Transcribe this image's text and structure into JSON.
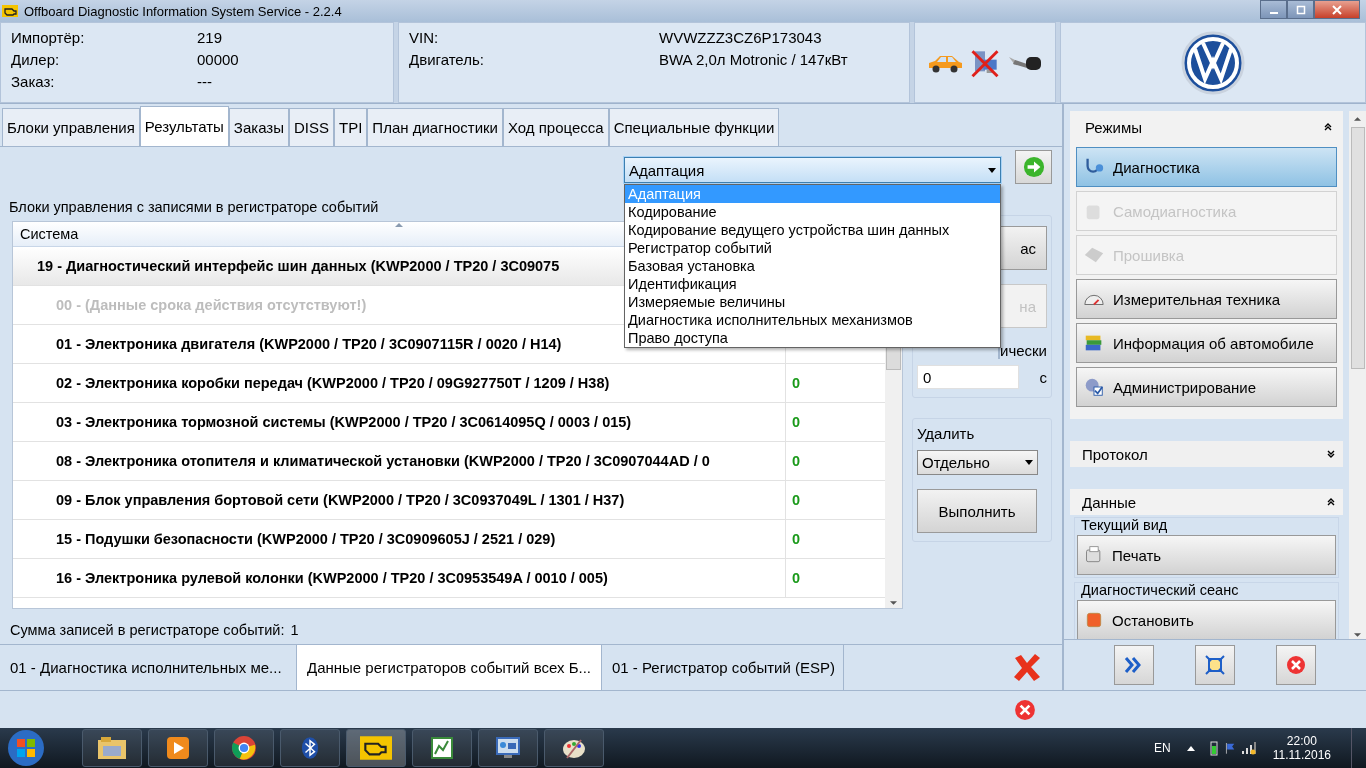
{
  "window": {
    "title": "Offboard Diagnostic Information System Service - 2.2.4"
  },
  "order": [
    {
      "label": "Импортёр:",
      "value": "219"
    },
    {
      "label": "Дилер:",
      "value": "00000"
    },
    {
      "label": "Заказ:",
      "value": "---"
    }
  ],
  "vehicle": [
    {
      "label": "VIN:",
      "value": "WVWZZZ3CZ6P173043"
    },
    {
      "label": "Двигатель:",
      "value": "BWA 2,0л Motronic / 147кВт"
    }
  ],
  "tabs": [
    {
      "label": "Блоки управления",
      "selected": false
    },
    {
      "label": "Результаты",
      "selected": true
    },
    {
      "label": "Заказы",
      "selected": false
    },
    {
      "label": "DISS",
      "selected": false
    },
    {
      "label": "TPI",
      "selected": false
    },
    {
      "label": "План диагностики",
      "selected": false
    },
    {
      "label": "Ход процесса",
      "selected": false
    },
    {
      "label": "Специальные функции",
      "selected": false
    }
  ],
  "function_select": {
    "value": "Адаптация",
    "expanded": true,
    "options": [
      {
        "label": "Адаптация",
        "selected": true
      },
      {
        "label": "Кодирование",
        "selected": false
      },
      {
        "label": "Кодирование ведущего устройства шин данных",
        "selected": false
      },
      {
        "label": "Регистратор событий",
        "selected": false
      },
      {
        "label": "Базовая установка",
        "selected": false
      },
      {
        "label": "Идентификация",
        "selected": false
      },
      {
        "label": "Измеряемые величины",
        "selected": false
      },
      {
        "label": "Диагностика исполнительных механизмов",
        "selected": false
      },
      {
        "label": "Право доступа",
        "selected": false
      }
    ]
  },
  "table": {
    "caption": "Блоки управления с записями в регистраторе событий",
    "columns": [
      "Система"
    ],
    "rows": [
      {
        "kind": "group",
        "name": "19 - Диагностический интерфейс шин данных  (KWP2000 / TP20 / 3C09075"
      },
      {
        "kind": "disabled",
        "name": "00 -   (Данные срока действия отсутствуют!)"
      },
      {
        "kind": "item",
        "name": "01 - Электроника двигателя  (KWP2000 / TP20 / 3C0907115R / 0020 / H14)"
      },
      {
        "kind": "item",
        "name": "02 - Электроника коробки передач  (KWP2000 / TP20 / 09G927750T / 1209 / H38)",
        "value": "0"
      },
      {
        "kind": "item",
        "name": "03 - Электроника тормозной системы  (KWP2000 / TP20 / 3C0614095Q / 0003 / 015)",
        "value": "0"
      },
      {
        "kind": "item",
        "name": "08 - Электроника отопителя и климатической установки  (KWP2000 / TP20 / 3C0907044AD / 0",
        "value": "0"
      },
      {
        "kind": "item",
        "name": "09 - Блок управления бортовой сети  (KWP2000 / TP20 / 3C0937049L / 1301 / H37)",
        "value": "0"
      },
      {
        "kind": "item",
        "name": "15 - Подушки безопасности  (KWP2000 / TP20 / 3C0909605J / 2521 / 029)",
        "value": "0"
      },
      {
        "kind": "item",
        "name": "16 - Электроника рулевой колонки  (KWP2000 / TP20 / 3C0953549A / 0010 / 005)",
        "value": "0"
      }
    ]
  },
  "side_buttons": [
    {
      "label": "ас",
      "disabled": false
    },
    {
      "label": "на",
      "disabled": true
    }
  ],
  "interval": {
    "title": "ически",
    "value": "0",
    "unit": "с"
  },
  "delete": {
    "title": "Удалить",
    "select": "Отдельно",
    "button": "Выполнить"
  },
  "summary": {
    "label": "Сумма записей в регистраторе событий:",
    "value": "1"
  },
  "bottom_tabs": [
    {
      "label": "01 - Диагностика исполнительных ме...",
      "selected": false
    },
    {
      "label": "Данные регистраторов событий всех Б...",
      "selected": true
    },
    {
      "label": "01 - Регистратор событий (ESP)",
      "selected": false
    }
  ],
  "sidebar": [
    {
      "kind": "modes",
      "title": "Режимы",
      "expanded": true,
      "items": [
        {
          "label": "Диагностика",
          "selected": true,
          "disabled": false
        },
        {
          "label": "Самодиагностика",
          "selected": false,
          "disabled": true
        },
        {
          "label": "Прошивка",
          "selected": false,
          "disabled": true
        },
        {
          "label": "Измерительная техника",
          "selected": false,
          "disabled": false
        },
        {
          "label": "Информация об автомобиле",
          "selected": false,
          "disabled": false
        },
        {
          "label": "Администрирование",
          "selected": false,
          "disabled": false
        }
      ]
    },
    {
      "kind": "collapsed",
      "title": "Протокол",
      "expanded": false
    },
    {
      "kind": "data",
      "title": "Данные",
      "expanded": true,
      "groups": [
        {
          "title": "Текущий вид",
          "button": "Печать"
        },
        {
          "title": "Диагностический сеанс",
          "button": "Остановить"
        }
      ]
    }
  ],
  "taskbar": {
    "language": "EN",
    "time": "22:00",
    "date": "11.11.2016"
  }
}
